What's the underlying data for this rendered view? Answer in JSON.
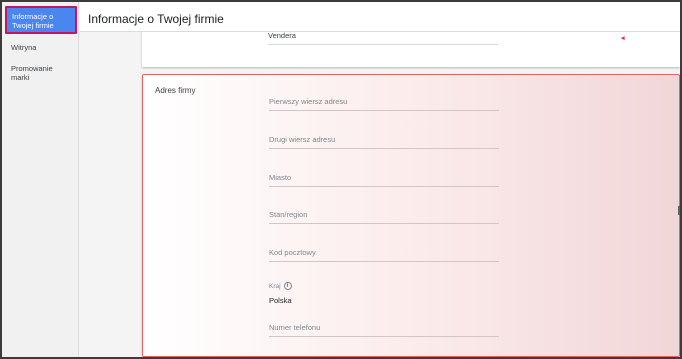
{
  "sidebar": {
    "items": [
      {
        "label": "Informacje o Twojej firmie",
        "active": true
      },
      {
        "label": "Witryna"
      },
      {
        "label": "Promowanie marki"
      }
    ]
  },
  "header": {
    "title": "Informacje o Twojej firmie"
  },
  "top_card": {
    "field_value": "Vendera"
  },
  "address_card": {
    "section_label": "Adres firmy",
    "fields": {
      "line1": "Pierwszy wiersz adresu",
      "line2": "Drugi wiersz adresu",
      "city": "Miasto",
      "state": "Stan/region",
      "postal": "Kod pocztowy",
      "country_label": "Kraj",
      "country_value": "Polska",
      "phone": "Numer telefonu"
    }
  },
  "colors": {
    "accent": "#4a86f0",
    "highlight_border": "#e06666"
  }
}
